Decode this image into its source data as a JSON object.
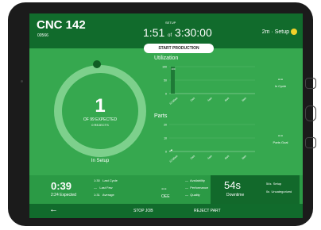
{
  "header": {
    "machine_name": "CNC 142",
    "machine_id": "00566",
    "mode_label": "SETUP",
    "timer_elapsed": "1:51",
    "timer_of": "of",
    "timer_total": "3:30:00",
    "status_text": "2m · Setup",
    "status_color": "#f2d02a",
    "start_button": "START PRODUCTION"
  },
  "progress": {
    "count": "1",
    "expected": "OF 99 EXPECTED",
    "rejects": "0 REJECTS",
    "label": "In Setup"
  },
  "utilization": {
    "title": "Utilization",
    "side_value": "--",
    "side_label": "In Cycle",
    "chart_data": {
      "type": "bar",
      "categories": [
        "12:00am",
        "2am",
        "4am",
        "6am",
        "8am"
      ],
      "values": [
        100,
        0,
        0,
        0,
        0
      ],
      "bar_label": "100",
      "ylim": [
        0,
        100
      ],
      "yticks": [
        "100",
        "50",
        "0"
      ]
    }
  },
  "parts": {
    "title": "Parts",
    "side_value": "--",
    "side_label": "Parts Goal",
    "chart_data": {
      "type": "line",
      "categories": [
        "12:00am",
        "2am",
        "4am",
        "6am",
        "8am"
      ],
      "values": [
        1
      ],
      "ylim": [
        0,
        20
      ],
      "yticks": [
        "20",
        "10",
        "0"
      ]
    }
  },
  "stats": {
    "cycle_time": "0:39",
    "cycle_expected": "2:24 Expected",
    "last_cycle_value": "1:30",
    "last_cycle_label": "Last Cycle",
    "last_few_value": "—",
    "last_few_label": "Last Few",
    "average_value": "1:31",
    "average_label": "Average",
    "oee_value": "--",
    "oee_label": "OEE",
    "availability_value": "—",
    "availability_label": "Availability",
    "performance_value": "—",
    "performance_label": "Performance",
    "quality_value": "—",
    "quality_label": "Quality",
    "downtime_value": "54s",
    "downtime_label": "Downtime",
    "setup_value": "54s",
    "setup_label": "Setup",
    "uncat_value": "0s",
    "uncat_label": "Uncategorized"
  },
  "footer": {
    "back_icon": "arrow-left-icon",
    "stop_job": "STOP JOB",
    "reject_part": "REJECT PART",
    "screen_icon": "monitor-icon"
  },
  "colors": {
    "background": "#36a84f",
    "header": "#116b2c",
    "ring": "#7dd08c",
    "downtime": "#12692b"
  }
}
